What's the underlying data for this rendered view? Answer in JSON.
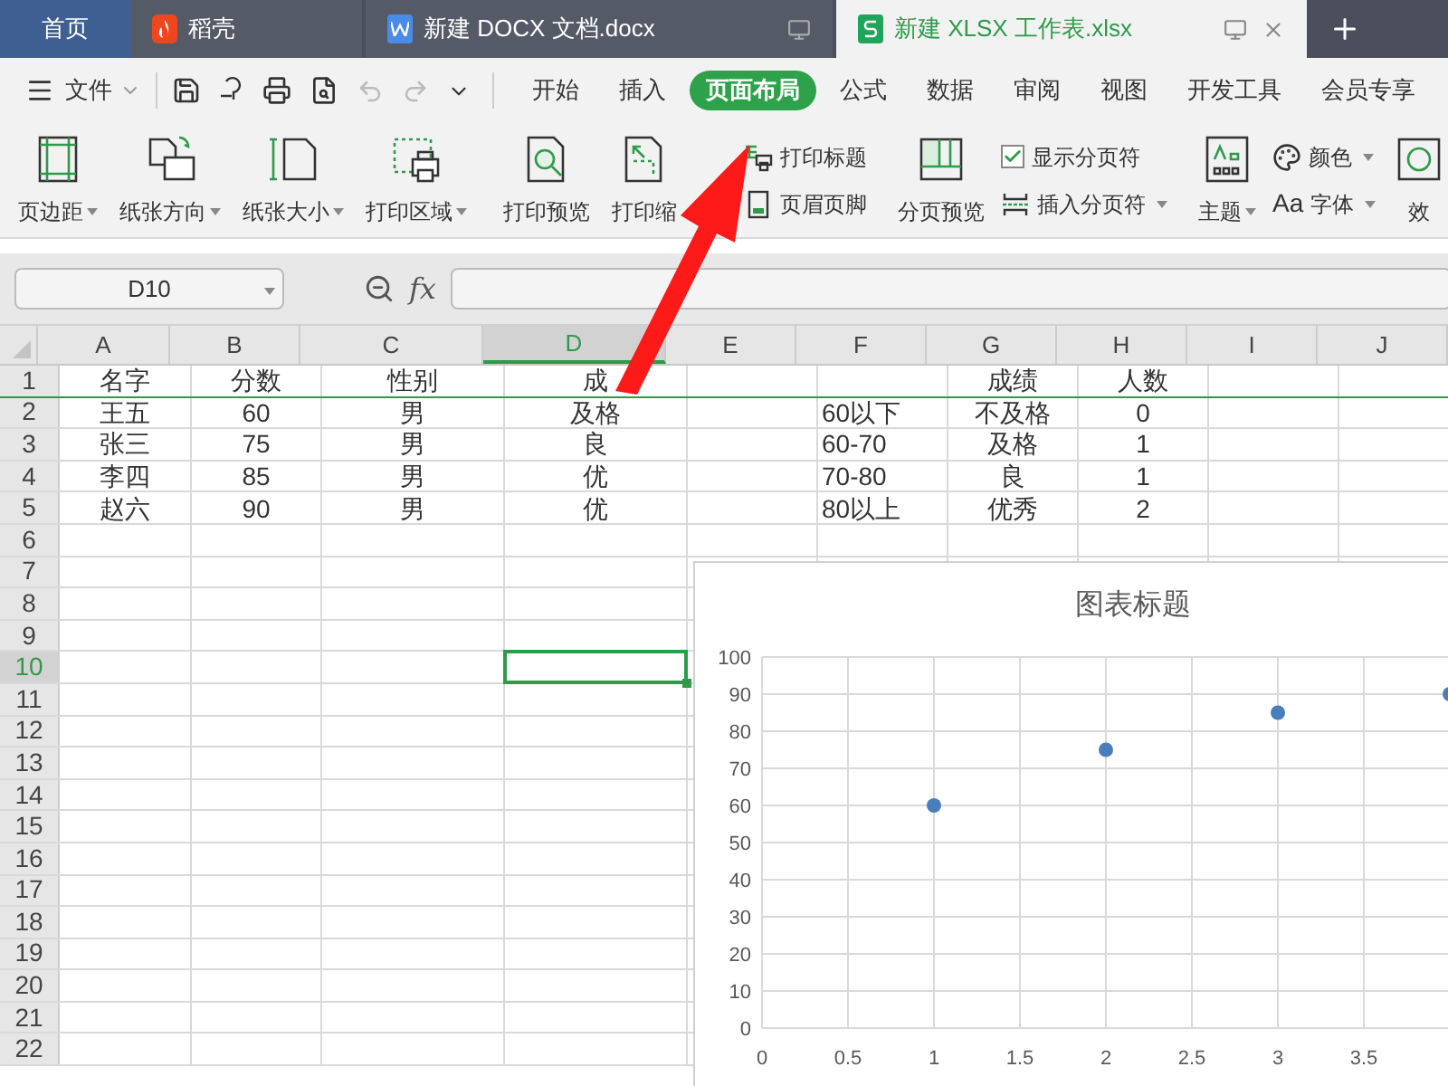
{
  "tabs": [
    {
      "label": "首页",
      "kind": "home",
      "selected": false
    },
    {
      "label": "稻壳",
      "kind": "daoke",
      "selected": false
    },
    {
      "label": "新建 DOCX 文档.docx",
      "kind": "doc",
      "selected": false
    },
    {
      "label": "新建 XLSX 工作表.xlsx",
      "kind": "sheet",
      "selected": true
    }
  ],
  "menu": {
    "file": "文件",
    "tabs": [
      {
        "label": "开始",
        "selected": false
      },
      {
        "label": "插入",
        "selected": false
      },
      {
        "label": "页面布局",
        "selected": true
      },
      {
        "label": "公式",
        "selected": false
      },
      {
        "label": "数据",
        "selected": false
      },
      {
        "label": "审阅",
        "selected": false
      },
      {
        "label": "视图",
        "selected": false
      },
      {
        "label": "开发工具",
        "selected": false
      },
      {
        "label": "会员专享",
        "selected": false
      }
    ]
  },
  "ribbon": [
    {
      "kind": "big",
      "label": "页边距",
      "dropdown": true
    },
    {
      "kind": "big",
      "label": "纸张方向",
      "dropdown": true
    },
    {
      "kind": "big",
      "label": "纸张大小",
      "dropdown": true
    },
    {
      "kind": "big",
      "label": "打印区域",
      "dropdown": true
    },
    {
      "kind": "sep"
    },
    {
      "kind": "big",
      "label": "打印预览",
      "dropdown": false
    },
    {
      "kind": "big",
      "label": "打印缩",
      "dropdown": false
    },
    {
      "kind": "stack",
      "items": [
        {
          "label": "打印标题",
          "dropdown": false
        },
        {
          "label": "页眉页脚",
          "dropdown": false
        }
      ]
    },
    {
      "kind": "sep"
    },
    {
      "kind": "big",
      "label": "分页预览",
      "dropdown": false
    },
    {
      "kind": "stack",
      "items": [
        {
          "label": "显示分页符",
          "checked": true,
          "dropdown": false
        },
        {
          "label": "插入分页符",
          "dropdown": true
        }
      ]
    },
    {
      "kind": "sep"
    },
    {
      "kind": "big",
      "label": "主题",
      "dropdown": true
    },
    {
      "kind": "stack",
      "items": [
        {
          "label": "颜色",
          "dropdown": true
        },
        {
          "label": "字体",
          "prefix": "Aa",
          "dropdown": true
        }
      ]
    },
    {
      "kind": "big",
      "label": "效",
      "dropdown": false
    }
  ],
  "formula_bar": {
    "name_box": "D10",
    "fx": "fx"
  },
  "sheet": {
    "columns": [
      {
        "label": "A",
        "selected": false
      },
      {
        "label": "B",
        "selected": false
      },
      {
        "label": "C",
        "selected": false
      },
      {
        "label": "D",
        "selected": true
      },
      {
        "label": "E",
        "selected": false
      },
      {
        "label": "F",
        "selected": false
      },
      {
        "label": "G",
        "selected": false
      },
      {
        "label": "H",
        "selected": false
      },
      {
        "label": "I",
        "selected": false
      },
      {
        "label": "J",
        "selected": false
      }
    ],
    "rows": [
      {
        "number": "1",
        "selected": false,
        "cells": {
          "A": "名字",
          "B": "分数",
          "C": "性别",
          "D": "成",
          "G": "成绩",
          "H": "人数"
        }
      },
      {
        "number": "2",
        "selected": false,
        "cells": {
          "A": "王五",
          "B": "60",
          "C": "男",
          "D": "及格",
          "F": "60以下",
          "G": "不及格",
          "H": "0"
        }
      },
      {
        "number": "3",
        "selected": false,
        "cells": {
          "A": "张三",
          "B": "75",
          "C": "男",
          "D": "良",
          "F": "60-70",
          "G": "及格",
          "H": "1"
        }
      },
      {
        "number": "4",
        "selected": false,
        "cells": {
          "A": "李四",
          "B": "85",
          "C": "男",
          "D": "优",
          "F": "70-80",
          "G": "良",
          "H": "1"
        }
      },
      {
        "number": "5",
        "selected": false,
        "cells": {
          "A": "赵六",
          "B": "90",
          "C": "男",
          "D": "优",
          "F": "80以上",
          "G": "优秀",
          "H": "2"
        }
      },
      {
        "number": "6",
        "selected": false
      },
      {
        "number": "7",
        "selected": false
      },
      {
        "number": "8",
        "selected": false
      },
      {
        "number": "9",
        "selected": false
      },
      {
        "number": "10",
        "selected": true
      },
      {
        "number": "11",
        "selected": false
      },
      {
        "number": "12",
        "selected": false
      },
      {
        "number": "13",
        "selected": false
      },
      {
        "number": "14",
        "selected": false
      },
      {
        "number": "15",
        "selected": false
      },
      {
        "number": "16",
        "selected": false
      },
      {
        "number": "17",
        "selected": false
      },
      {
        "number": "18",
        "selected": false
      },
      {
        "number": "19",
        "selected": false
      },
      {
        "number": "20",
        "selected": false
      },
      {
        "number": "21",
        "selected": false
      },
      {
        "number": "22",
        "selected": false
      }
    ]
  },
  "chart": {
    "chart_data": {
      "type": "scatter",
      "title": "图表标题",
      "grid": true,
      "series": [
        {
          "color": "#4a7ebb",
          "values": [
            60,
            75,
            85,
            90
          ]
        }
      ],
      "x": [
        1,
        2,
        3,
        4
      ],
      "xlim": [
        0,
        4
      ],
      "ylim": [
        0,
        100
      ],
      "xticks": [
        {
          "value": 0,
          "label": "0"
        },
        {
          "value": 0.5,
          "label": "0.5"
        },
        {
          "value": 1,
          "label": "1"
        },
        {
          "value": 1.5,
          "label": "1.5"
        },
        {
          "value": 2,
          "label": "2"
        },
        {
          "value": 2.5,
          "label": "2.5"
        },
        {
          "value": 3,
          "label": "3"
        },
        {
          "value": 3.5,
          "label": "3.5"
        }
      ],
      "yticks": [
        {
          "value": 0,
          "label": "0"
        },
        {
          "value": 10,
          "label": "10"
        },
        {
          "value": 20,
          "label": "20"
        },
        {
          "value": 30,
          "label": "30"
        },
        {
          "value": 40,
          "label": "40"
        },
        {
          "value": 50,
          "label": "50"
        },
        {
          "value": 60,
          "label": "60"
        },
        {
          "value": 70,
          "label": "70"
        },
        {
          "value": 80,
          "label": "80"
        },
        {
          "value": 90,
          "label": "90"
        },
        {
          "value": 100,
          "label": "100"
        }
      ]
    }
  }
}
